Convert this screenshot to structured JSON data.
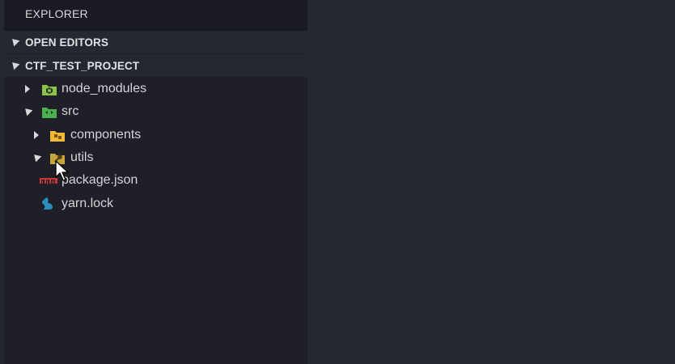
{
  "explorer": {
    "title": "EXPLORER"
  },
  "sections": {
    "open_editors": "OPEN EDITORS",
    "project": "CTF_TEST_PROJECT"
  },
  "tree": [
    {
      "label": "node_modules",
      "icon": "node-modules-folder-icon",
      "state": "collapsed"
    },
    {
      "label": "src",
      "icon": "src-folder-icon",
      "state": "expanded"
    },
    {
      "label": "components",
      "icon": "components-folder-icon",
      "state": "collapsed"
    },
    {
      "label": "utils",
      "icon": "utils-folder-icon",
      "state": "expanded"
    },
    {
      "label": "package.json",
      "icon": "npm-icon",
      "state": "file"
    },
    {
      "label": "yarn.lock",
      "icon": "yarn-icon",
      "state": "file"
    }
  ],
  "colors": {
    "sidebar_bg": "#1e1f27",
    "editor_bg": "#252731",
    "text": "#d4d5da",
    "node_modules_folder": "#8bc34a",
    "src_folder": "#4caf50",
    "components_folder": "#f5b935",
    "utils_folder": "#c7a43b",
    "npm": "#cb3837",
    "yarn": "#2c8ebb"
  }
}
